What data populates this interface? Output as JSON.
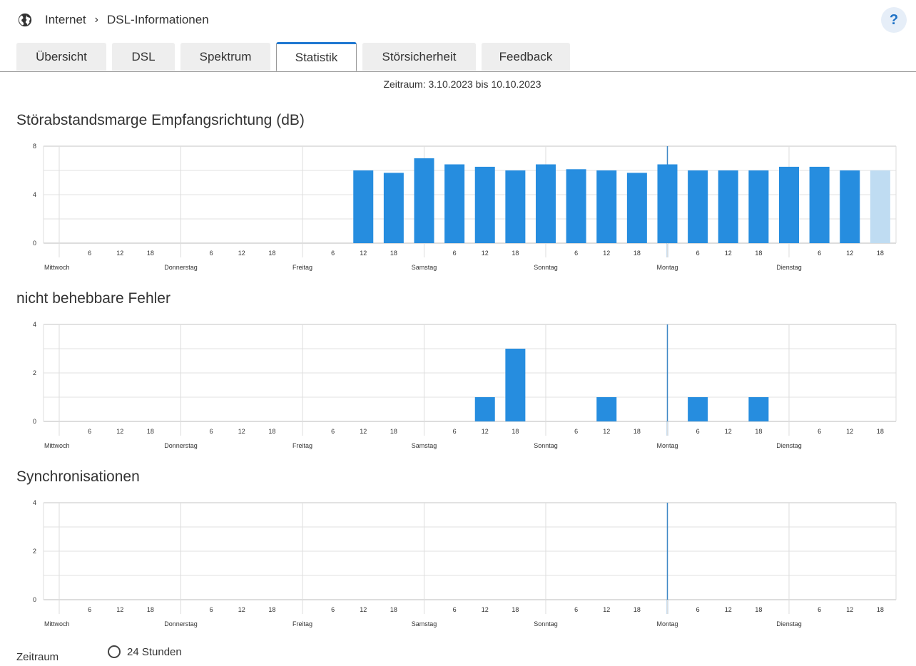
{
  "breadcrumb": {
    "icon": "globe-icon",
    "items": [
      "Internet",
      "DSL-Informationen"
    ]
  },
  "help_label": "?",
  "tabs": [
    {
      "label": "Übersicht",
      "active": false
    },
    {
      "label": "DSL",
      "active": false
    },
    {
      "label": "Spektrum",
      "active": false
    },
    {
      "label": "Statistik",
      "active": true
    },
    {
      "label": "Störsicherheit",
      "active": false
    },
    {
      "label": "Feedback",
      "active": false
    }
  ],
  "period_text": "Zeitraum: 3.10.2023 bis 10.10.2023",
  "colors": {
    "bar": "#268ddf",
    "bar_pending": "#bfdcf2",
    "today_line": "#3a86c4",
    "grid": "#dddddd"
  },
  "chart_data": [
    {
      "type": "bar",
      "title": "Störabstandsmarge Empfangsrichtung (dB)",
      "ylim": [
        0,
        8
      ],
      "yticks": [
        0,
        4,
        8
      ],
      "ygrid_step": 2,
      "days": [
        "Mittwoch",
        "Donnerstag",
        "Freitag",
        "Samstag",
        "Sonntag",
        "Montag",
        "Dienstag"
      ],
      "hour_ticks": [
        "6",
        "12",
        "18"
      ],
      "marker_day": "Montag",
      "bars": [
        {
          "day": 2,
          "hour": 12,
          "value": 6.0
        },
        {
          "day": 2,
          "hour": 18,
          "value": 5.8
        },
        {
          "day": 3,
          "hour": 0,
          "value": 7.0
        },
        {
          "day": 3,
          "hour": 6,
          "value": 6.5
        },
        {
          "day": 3,
          "hour": 12,
          "value": 6.3
        },
        {
          "day": 3,
          "hour": 18,
          "value": 6.0
        },
        {
          "day": 4,
          "hour": 0,
          "value": 6.5
        },
        {
          "day": 4,
          "hour": 6,
          "value": 6.1
        },
        {
          "day": 4,
          "hour": 12,
          "value": 6.0
        },
        {
          "day": 4,
          "hour": 18,
          "value": 5.8
        },
        {
          "day": 5,
          "hour": 0,
          "value": 6.5
        },
        {
          "day": 5,
          "hour": 6,
          "value": 6.0
        },
        {
          "day": 5,
          "hour": 12,
          "value": 6.0
        },
        {
          "day": 5,
          "hour": 18,
          "value": 6.0
        },
        {
          "day": 6,
          "hour": 0,
          "value": 6.3
        },
        {
          "day": 6,
          "hour": 6,
          "value": 6.3
        },
        {
          "day": 6,
          "hour": 12,
          "value": 6.0
        },
        {
          "day": 6,
          "hour": 18,
          "value": 6.0,
          "pending": true
        }
      ]
    },
    {
      "type": "bar",
      "title": "nicht behebbare Fehler",
      "ylim": [
        0,
        4
      ],
      "yticks": [
        0,
        2,
        4
      ],
      "ygrid_step": 1,
      "days": [
        "Mittwoch",
        "Donnerstag",
        "Freitag",
        "Samstag",
        "Sonntag",
        "Montag",
        "Dienstag"
      ],
      "hour_ticks": [
        "6",
        "12",
        "18"
      ],
      "marker_day": "Montag",
      "bars": [
        {
          "day": 3,
          "hour": 12,
          "value": 1
        },
        {
          "day": 3,
          "hour": 18,
          "value": 3
        },
        {
          "day": 4,
          "hour": 12,
          "value": 1
        },
        {
          "day": 5,
          "hour": 6,
          "value": 1
        },
        {
          "day": 5,
          "hour": 18,
          "value": 1
        }
      ]
    },
    {
      "type": "bar",
      "title": "Synchronisationen",
      "ylim": [
        0,
        4
      ],
      "yticks": [
        0,
        2,
        4
      ],
      "ygrid_step": 1,
      "days": [
        "Mittwoch",
        "Donnerstag",
        "Freitag",
        "Samstag",
        "Sonntag",
        "Montag",
        "Dienstag"
      ],
      "hour_ticks": [
        "6",
        "12",
        "18"
      ],
      "marker_day": "Montag",
      "bars": []
    }
  ],
  "footer": {
    "label": "Zeitraum",
    "option": "24 Stunden"
  }
}
